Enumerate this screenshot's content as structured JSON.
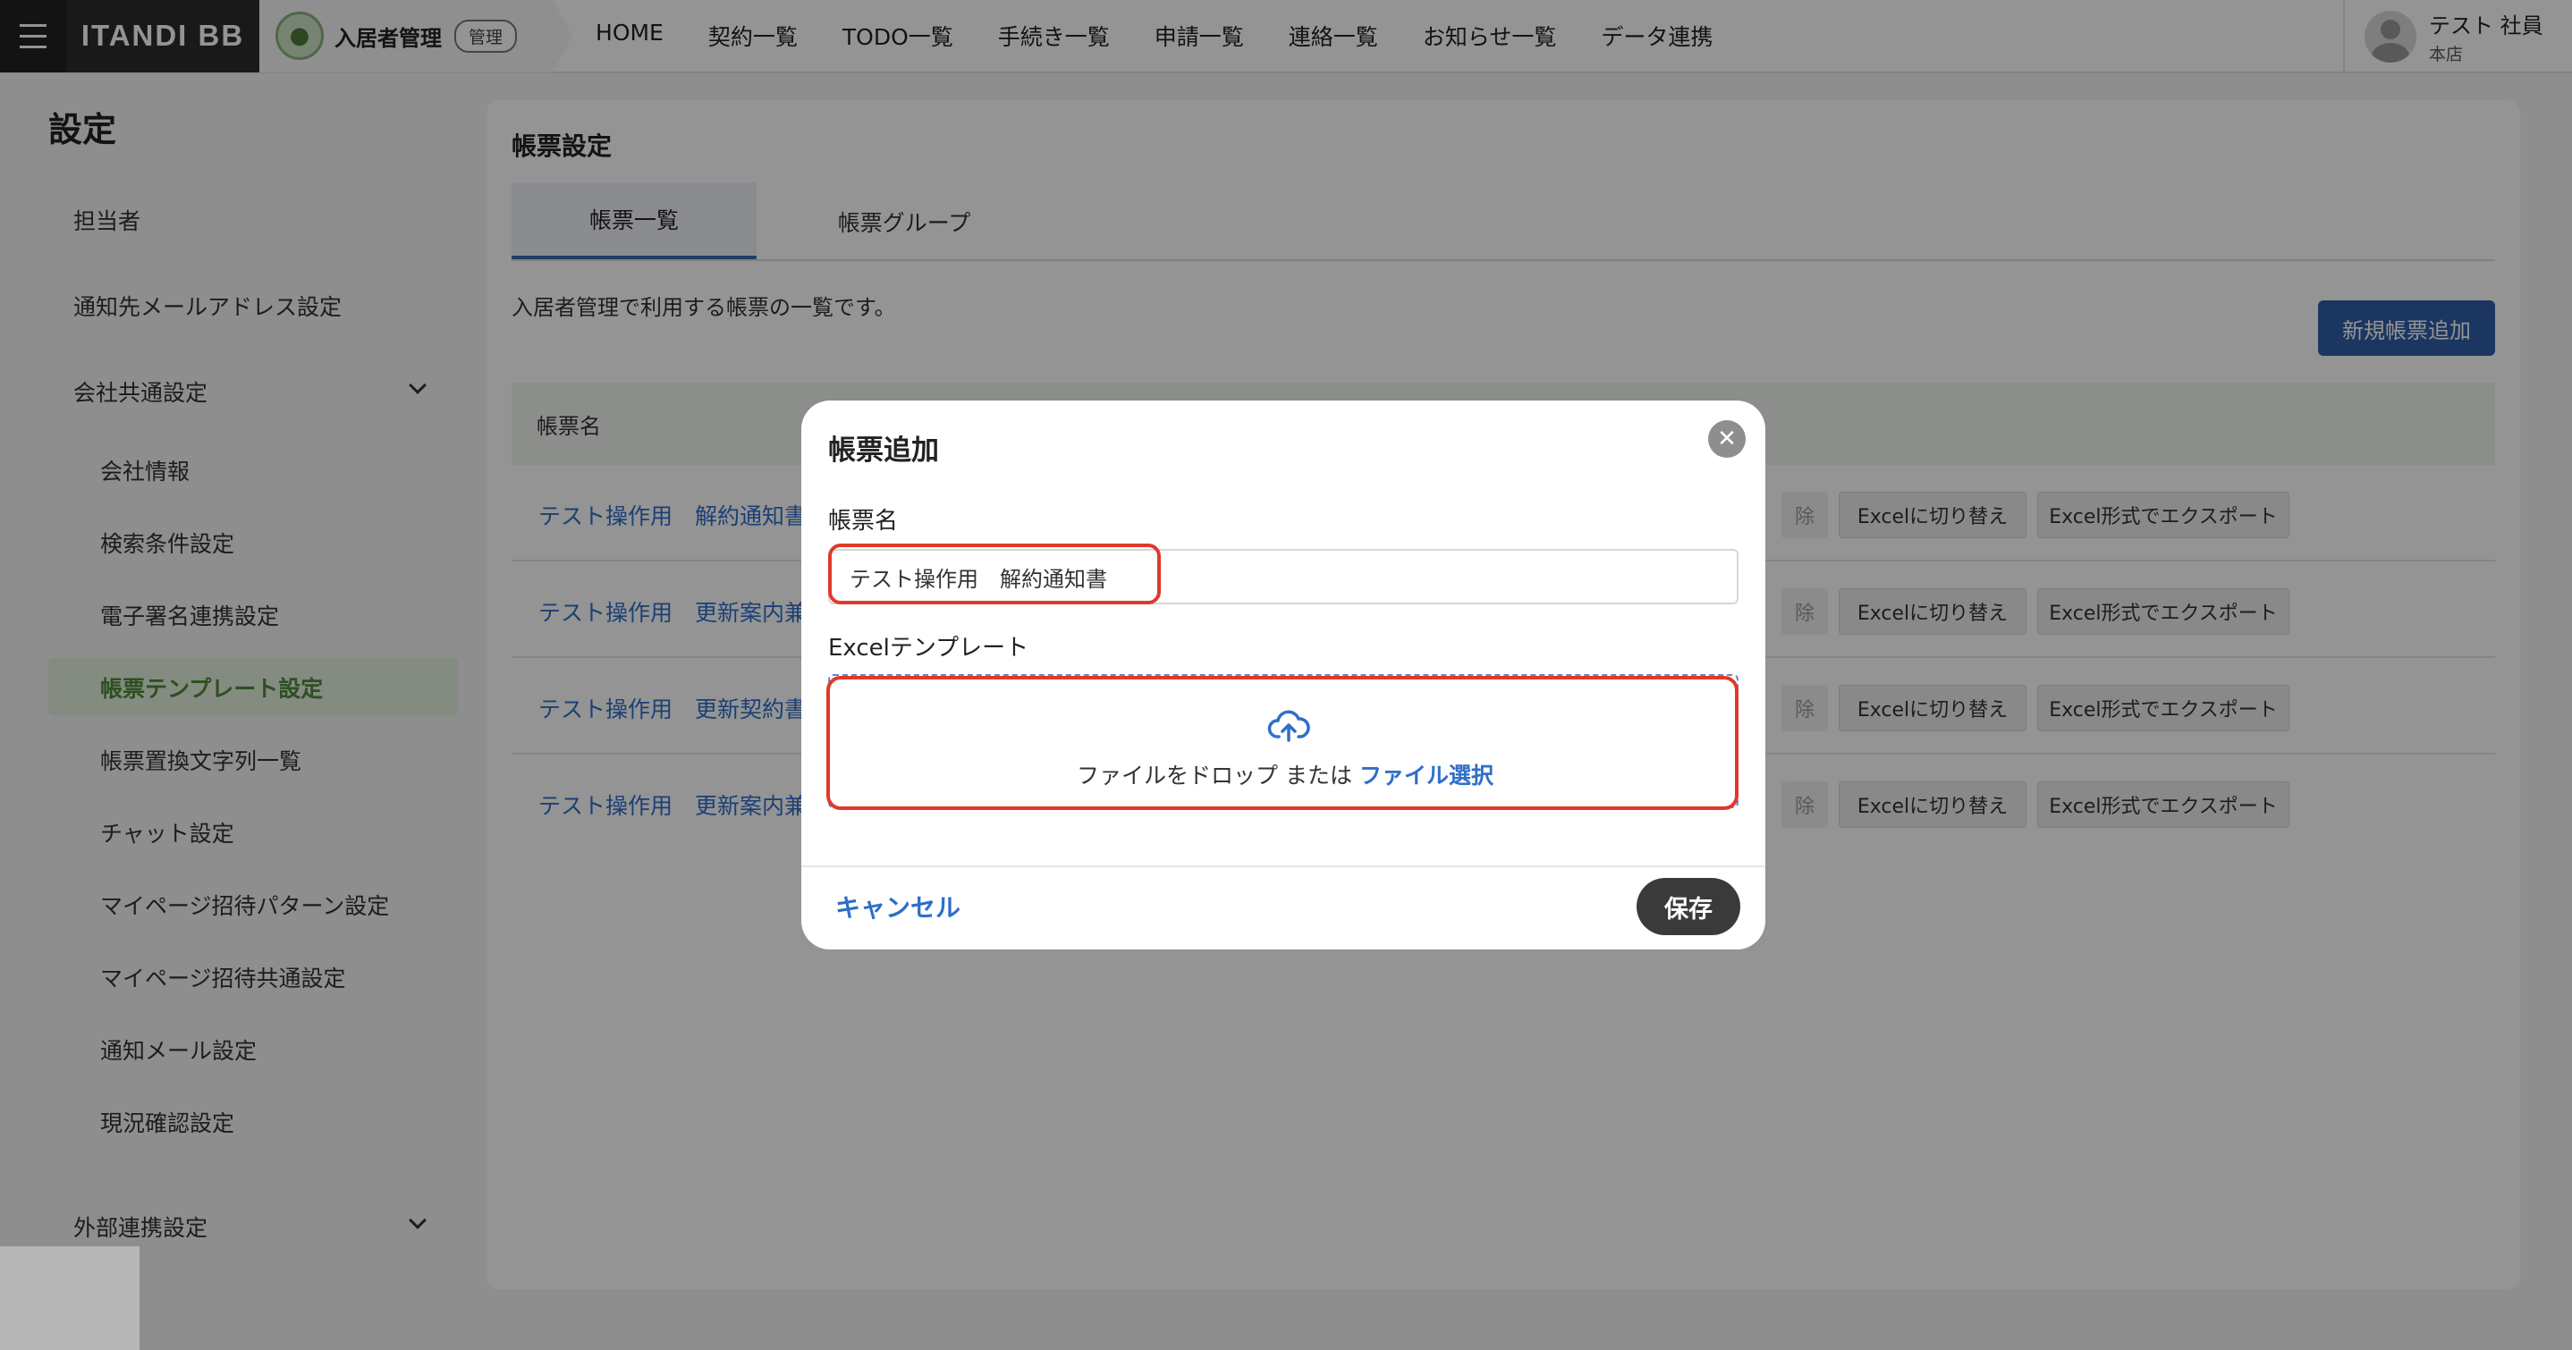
{
  "header": {
    "brand": "ITANDI BB",
    "product_name": "入居者管理",
    "product_badge": "管理",
    "nav": [
      "HOME",
      "契約一覧",
      "TODO一覧",
      "手続き一覧",
      "申請一覧",
      "連絡一覧",
      "お知らせ一覧",
      "データ連携"
    ],
    "user_name": "テスト 社員",
    "user_sub": "本店"
  },
  "sidebar": {
    "title": "設定",
    "items": [
      "担当者",
      "通知先メールアドレス設定",
      "会社共通設定",
      "会社情報",
      "検索条件設定",
      "電子署名連携設定",
      "帳票テンプレート設定",
      "帳票置換文字列一覧",
      "チャット設定",
      "マイページ招待パターン設定",
      "マイページ招待共通設定",
      "通知メール設定",
      "現況確認設定",
      "外部連携設定"
    ],
    "active_index": 6
  },
  "main": {
    "title": "帳票設定",
    "tabs": [
      "帳票一覧",
      "帳票グループ"
    ],
    "description": "入居者管理で利用する帳票の一覧です。",
    "new_button": "新規帳票追加",
    "table_header": "帳票名",
    "rows": [
      {
        "name": "テスト操作用　解約通知書"
      },
      {
        "name": "テスト操作用　更新案内兼"
      },
      {
        "name": "テスト操作用　更新契約書"
      },
      {
        "name": "テスト操作用　更新案内兼"
      }
    ],
    "row_actions": {
      "delete_partial": "除",
      "switch_excel": "Excelに切り替え",
      "export_excel": "Excel形式でエクスポート"
    }
  },
  "modal": {
    "title": "帳票追加",
    "name_label": "帳票名",
    "name_value": "テスト操作用　解約通知書",
    "template_label": "Excelテンプレート",
    "drop_text": "ファイルをドロップ または",
    "drop_link": "ファイル選択",
    "cancel": "キャンセル",
    "save": "保存"
  }
}
